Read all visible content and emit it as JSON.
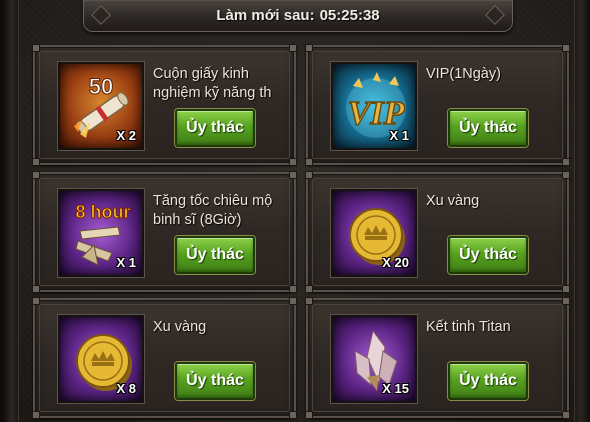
{
  "header": {
    "label": "Làm mới sau:",
    "countdown": "05:25:38"
  },
  "items": [
    {
      "name": "Cuộn giấy kinh nghiệm kỹ năng th",
      "quantity": "X 2",
      "icon": "skill-exp-scroll-icon",
      "icon_text": "50",
      "button_label": "Ủy thác"
    },
    {
      "name": "VIP(1Ngày)",
      "quantity": "X 1",
      "icon": "vip-card-icon",
      "icon_text": "VIP",
      "button_label": "Ủy thác"
    },
    {
      "name": "Tăng tốc chiêu mộ binh sĩ (8Giờ)",
      "quantity": "X 1",
      "icon": "recruit-speedup-icon",
      "icon_text": "8 hour",
      "button_label": "Ủy thác"
    },
    {
      "name": "Xu vàng",
      "quantity": "X 20",
      "icon": "gold-coin-icon",
      "button_label": "Ủy thác"
    },
    {
      "name": "Xu vàng",
      "quantity": "X 8",
      "icon": "gold-coin-icon",
      "button_label": "Ủy thác"
    },
    {
      "name": "Kết tinh Titan",
      "quantity": "X 15",
      "icon": "titan-crystal-icon",
      "button_label": "Ủy thác"
    }
  ],
  "colors": {
    "button_green": "#58a221",
    "panel_bg": "#2e2824",
    "orange_frame": "#9a3f12",
    "blue_frame": "#14678a",
    "purple_frame": "#5c2585"
  }
}
